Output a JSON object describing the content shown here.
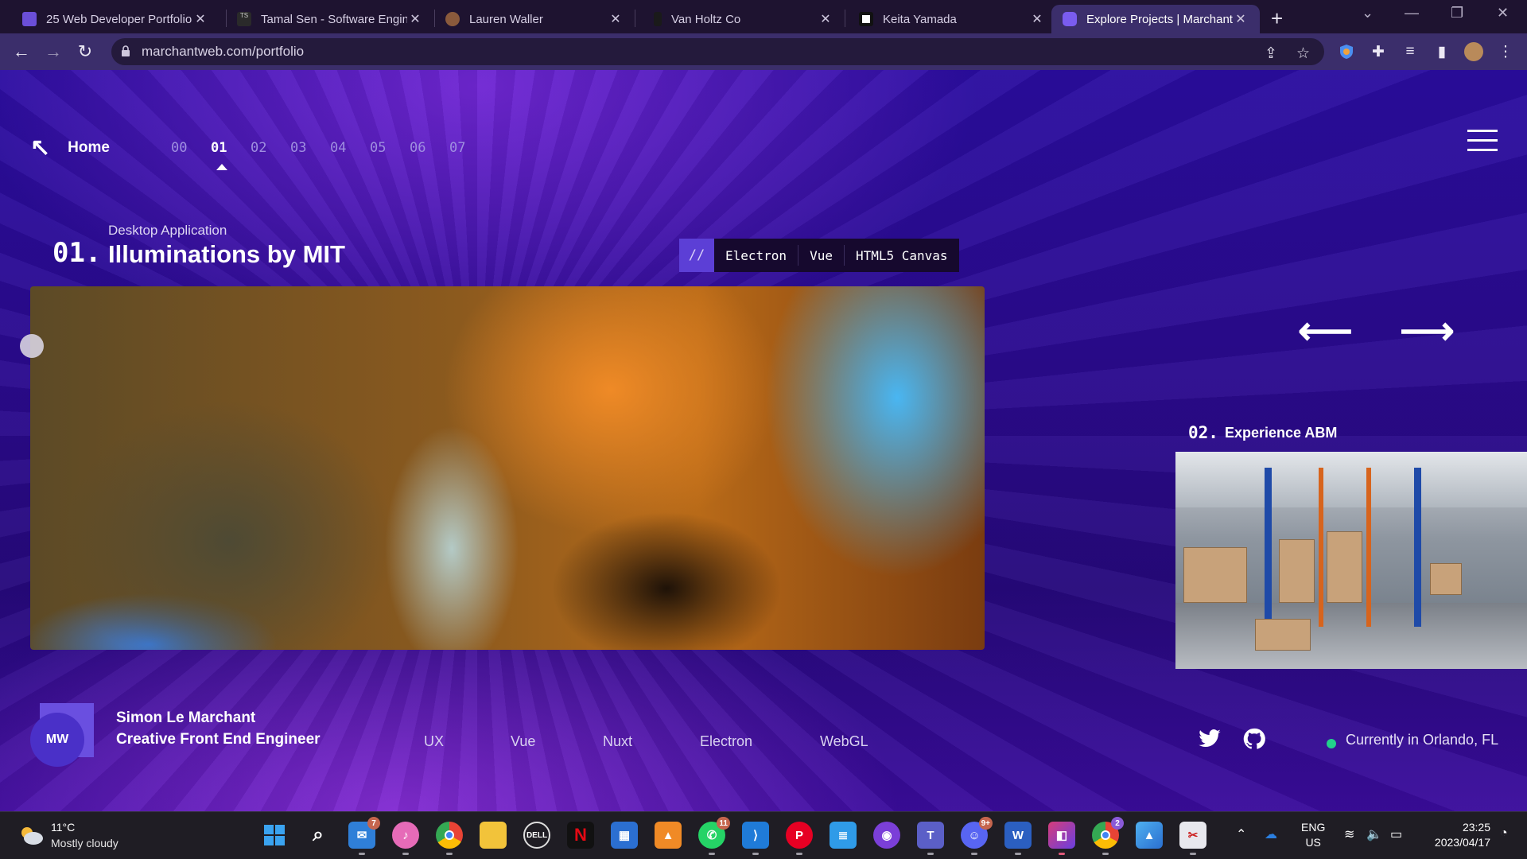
{
  "browser": {
    "tabs": [
      {
        "title": "25 Web Developer Portfolio",
        "favicon_color": "#6b4fd8"
      },
      {
        "title": "Tamal Sen - Software Engin",
        "favicon_color": "#2a2a2a"
      },
      {
        "title": "Lauren Waller",
        "favicon_color": "#8a5a3c"
      },
      {
        "title": "Van Holtz Co",
        "favicon_color": "#1a1a1a"
      },
      {
        "title": "Keita Yamada",
        "favicon_color": "#ffffff"
      },
      {
        "title": "Explore Projects | Marchant",
        "favicon_color": "#7a5cf0"
      }
    ],
    "url": "marchantweb.com/portfolio"
  },
  "site": {
    "home_label": "Home",
    "project_indices": [
      "00",
      "01",
      "02",
      "03",
      "04",
      "05",
      "06",
      "07"
    ],
    "current_index": "01",
    "project": {
      "number": "01.",
      "category": "Desktop Application",
      "title": "Illuminations by MIT",
      "tag_prefix": "//",
      "tags": [
        "Electron",
        "Vue",
        "HTML5 Canvas"
      ]
    },
    "next_project": {
      "number": "02.",
      "title": "Experience ABM"
    },
    "profile": {
      "logo_text": "MW",
      "name": "Simon Le Marchant",
      "role": "Creative Front End Engineer"
    },
    "skills": [
      "UX",
      "Vue",
      "Nuxt",
      "Electron",
      "WebGL"
    ],
    "location": "Currently in Orlando, FL",
    "status_color": "#22d18b"
  },
  "taskbar": {
    "weather": {
      "temp": "11°C",
      "desc": "Mostly cloudy"
    },
    "badges": {
      "mail": "7",
      "whatsapp": "11",
      "discord": "9+",
      "chrome2": "2"
    },
    "lang": {
      "line1": "ENG",
      "line2": "US"
    },
    "clock": {
      "time": "23:25",
      "date": "2023/04/17"
    }
  }
}
